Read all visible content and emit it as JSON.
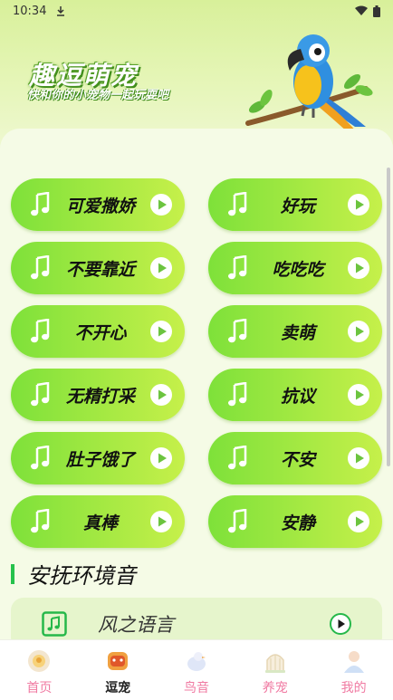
{
  "status_bar": {
    "time": "10:34"
  },
  "hero": {
    "title": "趣逗萌宠",
    "subtitle": "快和你的小宠物一起玩耍吧"
  },
  "sound_buttons": [
    {
      "label": "可爱撒娇"
    },
    {
      "label": "好玩"
    },
    {
      "label": "不要靠近"
    },
    {
      "label": "吃吃吃"
    },
    {
      "label": "不开心"
    },
    {
      "label": "卖萌"
    },
    {
      "label": "无精打采"
    },
    {
      "label": "抗议"
    },
    {
      "label": "肚子饿了"
    },
    {
      "label": "不安"
    },
    {
      "label": "真棒"
    },
    {
      "label": "安静"
    }
  ],
  "ambient_section": {
    "title": "安抚环境音",
    "items": [
      {
        "label": "风之语言"
      }
    ]
  },
  "bottom_nav": [
    {
      "label": "首页"
    },
    {
      "label": "逗宠"
    },
    {
      "label": "鸟音"
    },
    {
      "label": "养宠"
    },
    {
      "label": "我的"
    }
  ],
  "colors": {
    "accent_green": "#26c24c",
    "nav_pink": "#f07aa2",
    "button_start": "#7ee13a",
    "button_end": "#c6f04a"
  }
}
